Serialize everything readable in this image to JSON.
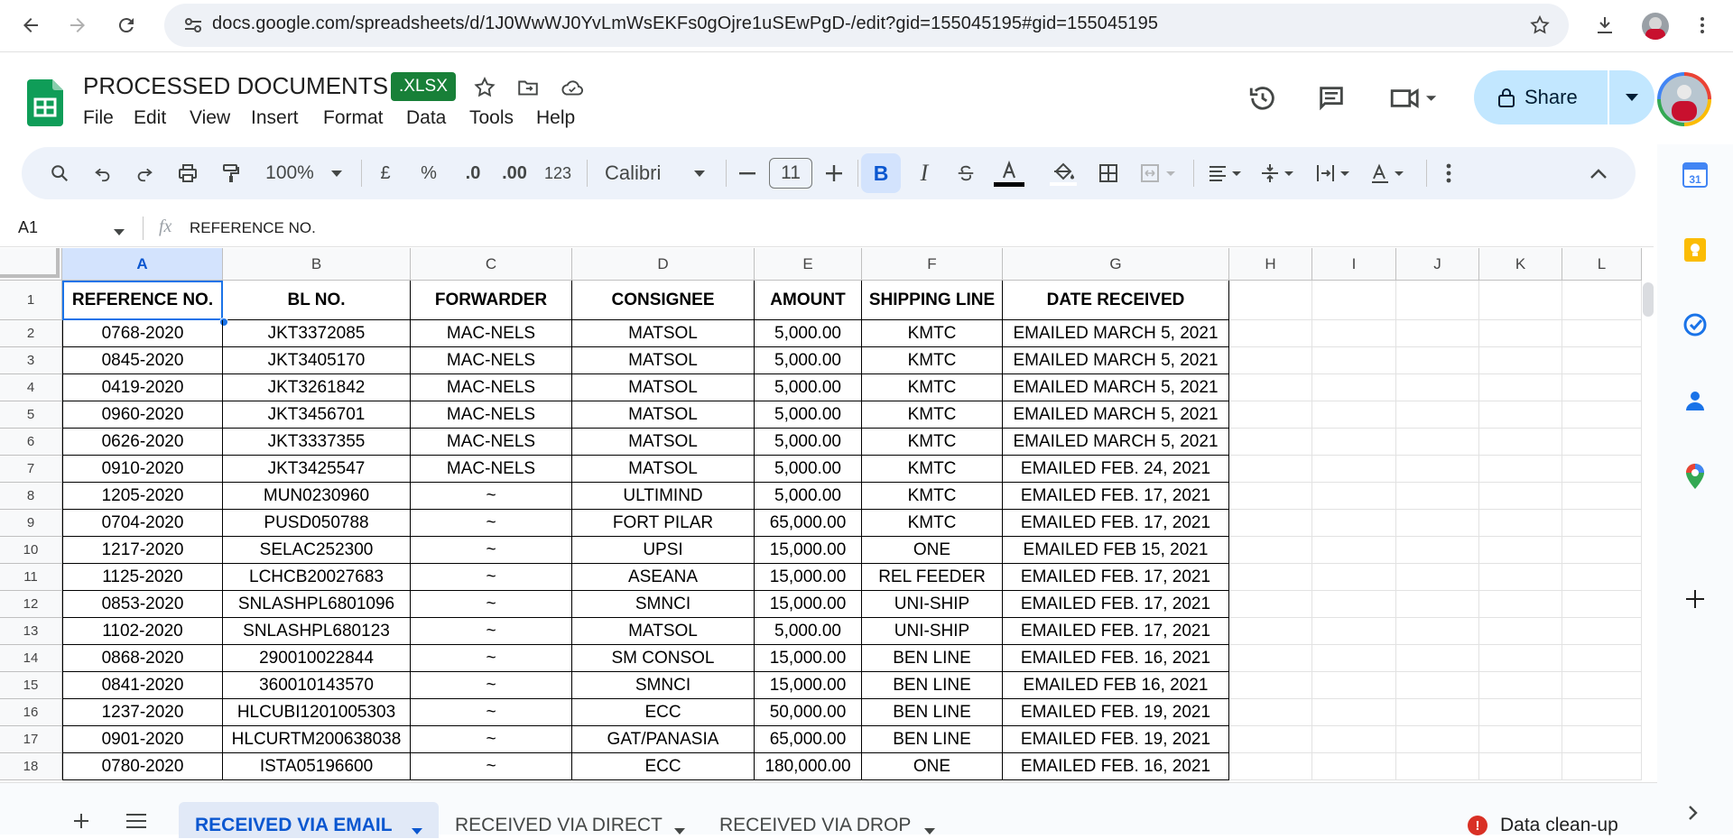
{
  "browser": {
    "url": "docs.google.com/spreadsheets/d/1J0WwWJ0YvLmWsEKFs0gOjre1uSEwPgD-/edit?gid=155045195#gid=155045195"
  },
  "doc": {
    "title": "PROCESSED DOCUMENTS",
    "badge": ".XLSX",
    "menus": [
      "File",
      "Edit",
      "View",
      "Insert",
      "Format",
      "Data",
      "Tools",
      "Help"
    ],
    "share_label": "Share"
  },
  "toolbar": {
    "zoom": "100%",
    "currency": "£",
    "percent": "%",
    "dec_decrease": ".0",
    "dec_increase": ".00",
    "number_format": "123",
    "font": "Calibri",
    "font_size": "11"
  },
  "formula": {
    "cell_ref": "A1",
    "fx": "fx",
    "content": "REFERENCE NO."
  },
  "grid": {
    "columns": [
      "A",
      "B",
      "C",
      "D",
      "E",
      "F",
      "G",
      "H",
      "I",
      "J",
      "K",
      "L"
    ],
    "header_row": [
      "REFERENCE NO.",
      "BL NO.",
      "FORWARDER",
      "CONSIGNEE",
      "AMOUNT",
      "SHIPPING LINE",
      "DATE RECEIVED"
    ],
    "rows": [
      [
        "2",
        "0768-2020",
        "JKT3372085",
        "MAC-NELS",
        "MATSOL",
        "5,000.00",
        "KMTC",
        "EMAILED MARCH 5, 2021"
      ],
      [
        "3",
        "0845-2020",
        "JKT3405170",
        "MAC-NELS",
        "MATSOL",
        "5,000.00",
        "KMTC",
        "EMAILED MARCH 5, 2021"
      ],
      [
        "4",
        "0419-2020",
        "JKT3261842",
        "MAC-NELS",
        "MATSOL",
        "5,000.00",
        "KMTC",
        "EMAILED MARCH 5, 2021"
      ],
      [
        "5",
        "0960-2020",
        "JKT3456701",
        "MAC-NELS",
        "MATSOL",
        "5,000.00",
        "KMTC",
        "EMAILED MARCH 5, 2021"
      ],
      [
        "6",
        "0626-2020",
        "JKT3337355",
        "MAC-NELS",
        "MATSOL",
        "5,000.00",
        "KMTC",
        "EMAILED MARCH 5, 2021"
      ],
      [
        "7",
        "0910-2020",
        "JKT3425547",
        "MAC-NELS",
        "MATSOL",
        "5,000.00",
        "KMTC",
        "EMAILED FEB. 24, 2021"
      ],
      [
        "8",
        "1205-2020",
        "MUN0230960",
        "~",
        "ULTIMIND",
        "5,000.00",
        "KMTC",
        "EMAILED FEB. 17, 2021"
      ],
      [
        "9",
        "0704-2020",
        "PUSD050788",
        "~",
        "FORT PILAR",
        "65,000.00",
        "KMTC",
        "EMAILED FEB. 17, 2021"
      ],
      [
        "10",
        "1217-2020",
        "SELAC252300",
        "~",
        "UPSI",
        "15,000.00",
        "ONE",
        "EMAILED FEB 15, 2021"
      ],
      [
        "11",
        "1125-2020",
        "LCHCB20027683",
        "~",
        "ASEANA",
        "15,000.00",
        "REL FEEDER",
        "EMAILED FEB. 17, 2021"
      ],
      [
        "12",
        "0853-2020",
        "SNLASHPL6801096",
        "~",
        "SMNCI",
        "15,000.00",
        "UNI-SHIP",
        "EMAILED FEB. 17, 2021"
      ],
      [
        "13",
        "1102-2020",
        "SNLASHPL680123",
        "~",
        "MATSOL",
        "5,000.00",
        "UNI-SHIP",
        "EMAILED FEB. 17, 2021"
      ],
      [
        "14",
        "0868-2020",
        "290010022844",
        "~",
        "SM CONSOL",
        "15,000.00",
        "BEN LINE",
        "EMAILED FEB. 16, 2021"
      ],
      [
        "15",
        "0841-2020",
        "360010143570",
        "~",
        "SMNCI",
        "15,000.00",
        "BEN LINE",
        "EMAILED FEB 16, 2021"
      ],
      [
        "16",
        "1237-2020",
        "HLCUBI1201005303",
        "~",
        "ECC",
        "50,000.00",
        "BEN LINE",
        "EMAILED FEB. 19, 2021"
      ],
      [
        "17",
        "0901-2020",
        "HLCURTM200638038",
        "~",
        "GAT/PANASIA",
        "65,000.00",
        "BEN LINE",
        "EMAILED FEB. 19, 2021"
      ],
      [
        "18",
        "0780-2020",
        "ISTA05196600",
        "~",
        "ECC",
        "180,000.00",
        "ONE",
        "EMAILED FEB. 16, 2021"
      ]
    ]
  },
  "tabs": [
    {
      "label": "RECEIVED VIA EMAIL",
      "active": true
    },
    {
      "label": "RECEIVED VIA DIRECT",
      "active": false
    },
    {
      "label": "RECEIVED VIA DROP",
      "active": false
    }
  ],
  "footer": {
    "cleanup_label": "Data clean-up"
  },
  "colors": {
    "accent": "#0b57d0",
    "badge_green": "#188038",
    "share_bg": "#c2e7ff",
    "selection": "#1a73e8"
  }
}
